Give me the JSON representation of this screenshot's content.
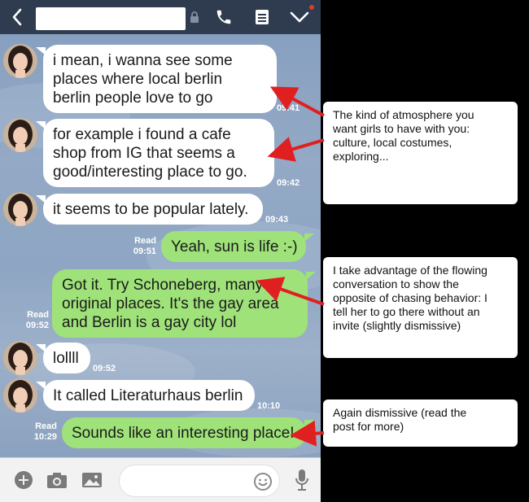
{
  "header": {
    "back_icon": "chevron-left-icon",
    "title": "",
    "lock_icon": "lock-icon",
    "call_icon": "phone-icon",
    "notes_icon": "notes-icon",
    "menu_icon": "chevron-down-icon"
  },
  "messages": [
    {
      "from": "them",
      "lines": [
        "i mean, i wanna see some",
        "places where local berlin",
        "berlin people love to go"
      ],
      "time": "09:41"
    },
    {
      "from": "them",
      "lines": [
        "for example i found a cafe",
        "shop from IG that seems a",
        "good/interesting place to go."
      ],
      "time": "09:42"
    },
    {
      "from": "them",
      "lines": [
        "it seems to be popular lately."
      ],
      "time": "09:43"
    },
    {
      "from": "me",
      "lines": [
        "Yeah, sun is life :-)"
      ],
      "read": "Read",
      "time": "09:51"
    },
    {
      "from": "me",
      "lines": [
        "Got it. Try Schoneberg, many",
        "original places. It's the gay area",
        "and Berlin is a gay city lol"
      ],
      "read": "Read",
      "time": "09:52"
    },
    {
      "from": "them",
      "lines": [
        "lollll"
      ],
      "time": "09:52"
    },
    {
      "from": "them",
      "lines": [
        "It called Literaturhaus berlin"
      ],
      "time": "10:10"
    },
    {
      "from": "me",
      "lines": [
        "Sounds like an interesting place!"
      ],
      "read": "Read",
      "time": "10:29"
    }
  ],
  "annotations": [
    {
      "lines": [
        "The kind of atmosphere you",
        "want girls to have with you:",
        "culture, local costumes,",
        "exploring..."
      ]
    },
    {
      "lines": [
        "I take advantage of the flowing",
        "conversation to show the",
        "opposite of chasing behavior: I",
        "tell her to go there without an",
        "invite (slightly dismissive)"
      ]
    },
    {
      "lines": [
        "Again dismissive (read the",
        "post for more)"
      ]
    }
  ],
  "bottom_bar": {
    "icons": [
      "plus-icon",
      "camera-icon",
      "image-icon",
      "emoji-icon",
      "microphone-icon"
    ],
    "input_placeholder": ""
  },
  "colors": {
    "header_bg": "#2f3c50",
    "chat_bg": "#8ea6c4",
    "incoming_bubble": "#ffffff",
    "outgoing_bubble": "#9fe27a",
    "arrow": "#e02020",
    "notification_dot": "#e03a2e"
  }
}
